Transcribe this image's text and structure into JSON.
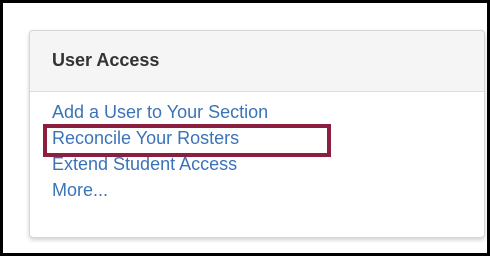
{
  "panel": {
    "title": "User Access",
    "links": [
      "Add a User to Your Section",
      "Reconcile Your Rosters",
      "Extend Student Access",
      "More..."
    ]
  },
  "colors": {
    "link": "#3b73b9",
    "highlight_border": "#8b1f3f",
    "header_bg": "#f5f5f5"
  }
}
